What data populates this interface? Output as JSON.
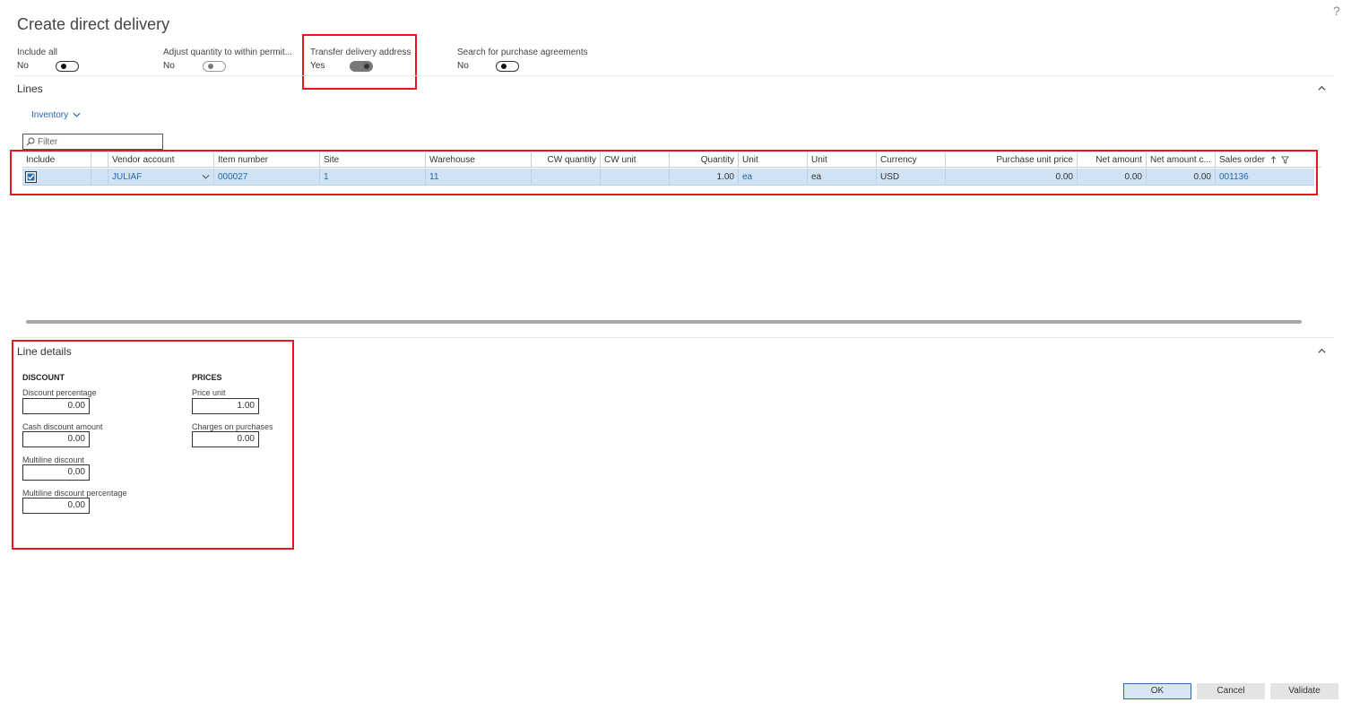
{
  "dialog": {
    "title": "Create direct delivery",
    "help_glyph": "?"
  },
  "options": [
    {
      "label": "Include all",
      "value": "No"
    },
    {
      "label": "Adjust quantity to within permit...",
      "value": "No"
    },
    {
      "label": "Transfer delivery address",
      "value": "Yes"
    },
    {
      "label": "Search for purchase agreements",
      "value": "No"
    }
  ],
  "lines": {
    "title": "Lines",
    "menu_label": "Inventory",
    "filter_placeholder": "Filter",
    "columns": [
      "Include",
      "",
      "Vendor account",
      "Item number",
      "Site",
      "Warehouse",
      "CW quantity",
      "CW unit",
      "Quantity",
      "Unit",
      "Unit",
      "Currency",
      "Purchase unit price",
      "Net amount",
      "Net amount c...",
      "Sales order"
    ],
    "rows": [
      {
        "include": true,
        "vendor_account": "JULIAF",
        "item_number": "000027",
        "site": "1",
        "warehouse": "11",
        "cw_quantity": "",
        "cw_unit": "",
        "quantity": "1.00",
        "unit": "ea",
        "unit2": "ea",
        "currency": "USD",
        "purchase_unit_price": "0.00",
        "net_amount": "0.00",
        "net_amount_c": "0.00",
        "sales_order": "001136"
      }
    ]
  },
  "line_details": {
    "title": "Line details",
    "discount": {
      "heading": "DISCOUNT",
      "fields": [
        {
          "label": "Discount percentage",
          "value": "0.00"
        },
        {
          "label": "Cash discount amount",
          "value": "0.00"
        },
        {
          "label": "Multiline discount",
          "value": "0.00"
        },
        {
          "label": "Multiline discount percentage",
          "value": "0.00"
        }
      ]
    },
    "prices": {
      "heading": "PRICES",
      "fields": [
        {
          "label": "Price unit",
          "value": "1.00"
        },
        {
          "label": "Charges on purchases",
          "value": "0.00"
        }
      ]
    }
  },
  "buttons": {
    "ok": "OK",
    "cancel": "Cancel",
    "validate": "Validate"
  },
  "colors": {
    "highlight_box": "#e8141e",
    "link": "#2266b0",
    "selected_row": "#cfe3f5"
  },
  "icons": [
    "help-icon",
    "chevron-up-icon",
    "chevron-down-icon",
    "search-icon",
    "sort-ascending-icon",
    "filter-icon",
    "checkbox-checked-icon"
  ]
}
